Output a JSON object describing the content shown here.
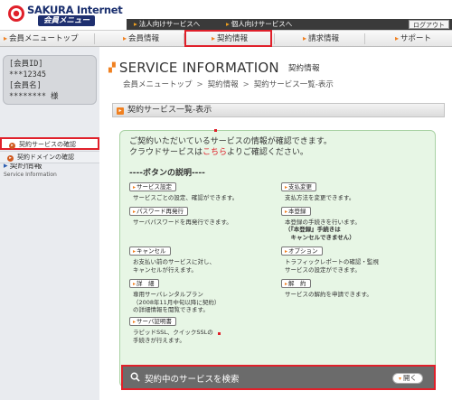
{
  "brand": {
    "name": "SAKURA Internet",
    "subtitle": "会員メニュー"
  },
  "topbar": {
    "corporate_link": "法人向けサービスへ",
    "personal_link": "個人向けサービスへ",
    "logout": "ログアウト"
  },
  "nav": {
    "items": [
      "会員メニュートップ",
      "会員情報",
      "契約情報",
      "請求情報",
      "サポート"
    ]
  },
  "user": {
    "id_label": "[会員ID]",
    "id_value": "***12345",
    "name_label": "[会員名]",
    "name_value": "******** 様"
  },
  "sidebar": {
    "section_title": "契約情報",
    "section_subtitle": "Service Information",
    "links": [
      "契約サービスの確認",
      "契約ドメインの確認"
    ]
  },
  "page": {
    "title": "SERVICE INFORMATION",
    "title_sub": "契約情報",
    "breadcrumb": [
      "会員メニュートップ",
      "契約情報",
      "契約サービス一覧-表示"
    ],
    "section_heading": "契約サービス一覧-表示"
  },
  "info": {
    "line1": "ご契約いただいているサービスの情報が確認できます。",
    "line2_prefix": "クラウドサービスは",
    "line2_link": "こちら",
    "line2_suffix": "よりご確認ください。",
    "legend": "----ボタンの説明----"
  },
  "buttons": {
    "service_settings": "サービス設定",
    "service_settings_desc": "サービスごとの設定、確認ができます。",
    "password_reissue": "パスワード再発行",
    "password_reissue_desc": "サーバパスワードを再発行できます。",
    "cancel": "キャンセル",
    "cancel_desc": "お支払い前のサービスに対し、\nキャンセルが行えます。",
    "detail": "詳　細",
    "detail_desc": "専用サーバレンタルプラン\n（2008年11月中旬以降に契約）\nの詳細情報を閲覧できます。",
    "cert": "サーバ証明書",
    "cert_desc": "ラピッドSSL、クイックSSLの\n手続きが行えます。",
    "payment_change": "支払変更",
    "payment_change_desc": "支払方法を変更できます。",
    "register": "本登録",
    "register_desc": "本登録の手続きを行います。",
    "register_note": "（『本登録』手続きは\n　キャンセルできません）",
    "option": "オプション",
    "option_desc": "トラフィックレポートの確認・監視\nサービスの設定ができます。",
    "terminate": "解　約",
    "terminate_desc": "サービスの解約を申請できます。"
  },
  "search": {
    "label": "契約中のサービスを検索",
    "open_button": "開く"
  },
  "colors": {
    "accent_red": "#e0202a",
    "accent_orange": "#f08020",
    "panel_green": "#e7f6e5",
    "brand_navy": "#1e2f6f"
  }
}
